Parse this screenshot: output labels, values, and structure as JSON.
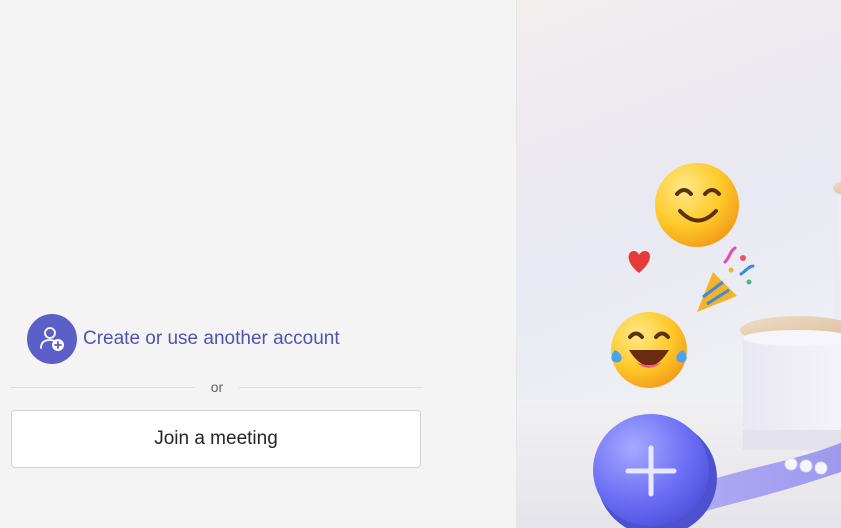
{
  "account": {
    "label": "Create or use another account",
    "icon": "person-add-icon"
  },
  "divider": {
    "label": "or"
  },
  "join": {
    "label": "Join a meeting"
  },
  "illustration": {
    "items": [
      "smiling-face-emoji",
      "heart-emoji",
      "party-popper-emoji",
      "tears-of-joy-emoji",
      "plus-coin",
      "platform-shelves"
    ]
  },
  "colors": {
    "accent": "#5b5fc7",
    "link": "#4f52b2",
    "background": "#f4f4f4"
  }
}
